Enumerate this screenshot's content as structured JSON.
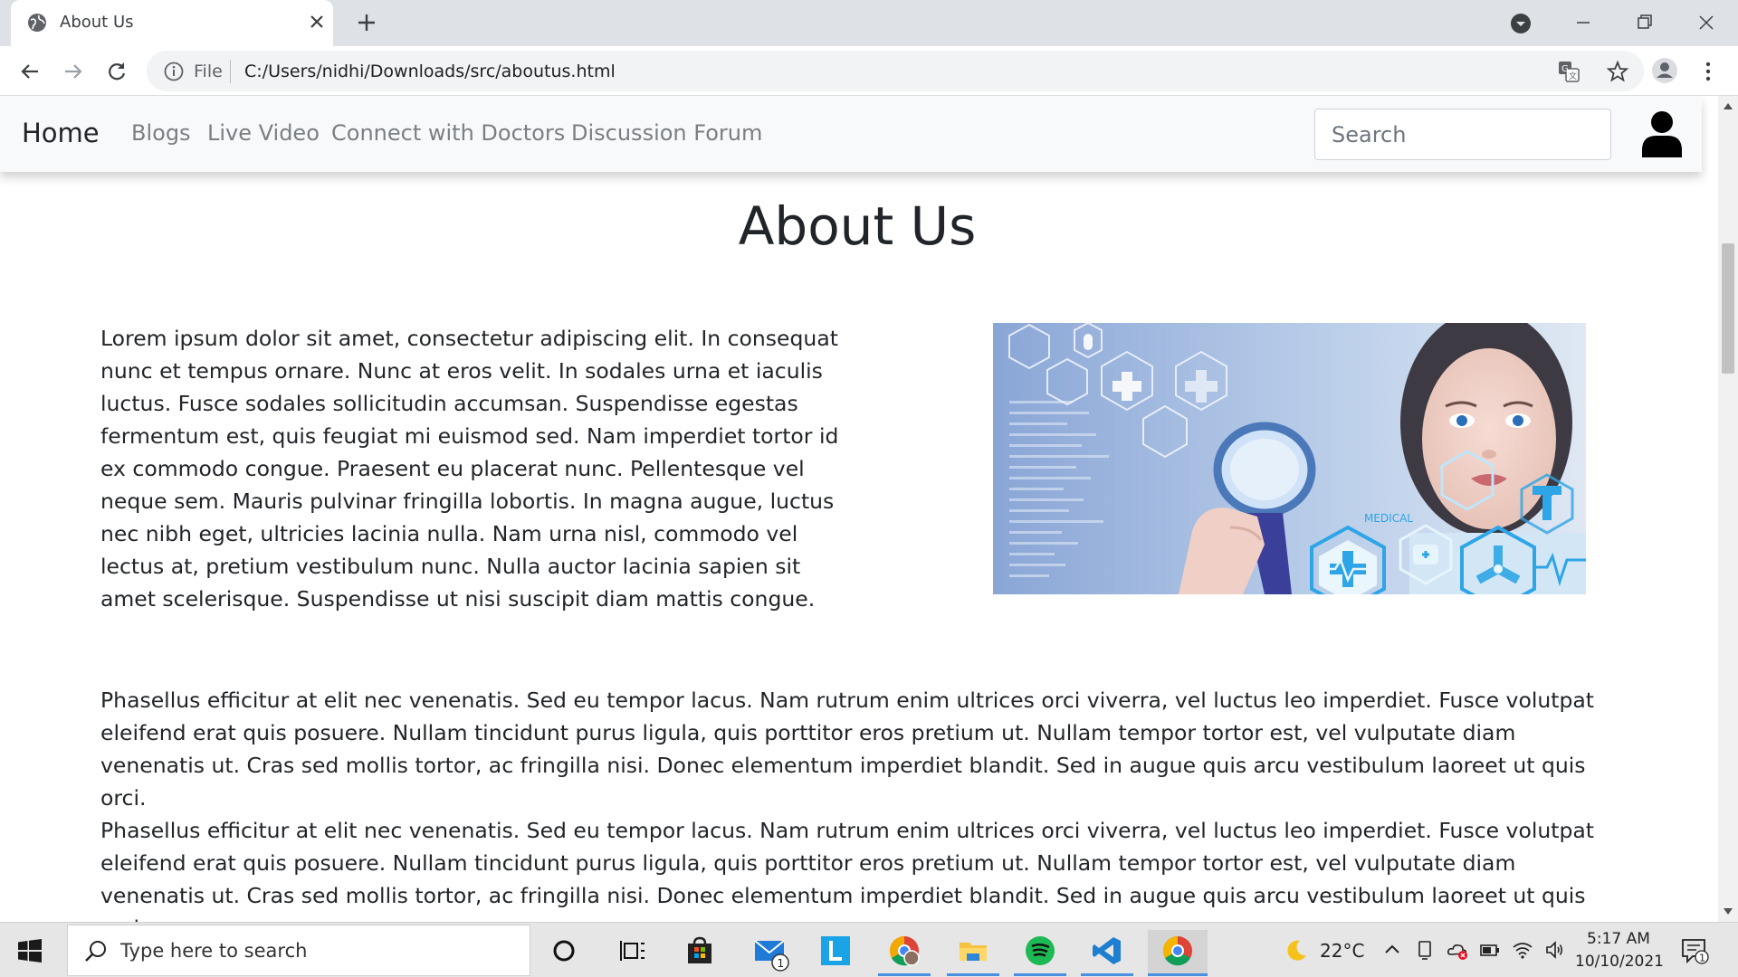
{
  "browser": {
    "tab_title": "About Us",
    "omnibox_scheme": "File",
    "omnibox_url": "C:/Users/nidhi/Downloads/src/aboutus.html"
  },
  "nav": {
    "brand": "Home",
    "links": [
      "Blogs",
      "Live Video",
      "Connect with Doctors",
      "Discussion Forum"
    ],
    "search_placeholder": "Search"
  },
  "page": {
    "title": "About Us",
    "intro": "Lorem ipsum dolor sit amet, consectetur adipiscing elit. In consequat nunc et tempus ornare. Nunc at eros velit. In sodales urna et iaculis luctus. Fusce sodales sollicitudin accumsan. Suspendisse egestas fermentum est, quis feugiat mi euismod sed. Nam imperdiet tortor id ex commodo congue. Praesent eu placerat nunc. Pellentesque vel neque sem. Mauris pulvinar fringilla lobortis. In magna augue, luctus nec nibh eget, ultricies lacinia nulla. Nam urna nisl, commodo vel lectus at, pretium vestibulum nunc. Nulla auctor lacinia sapien sit amet scelerisque. Suspendisse ut nisi suscipit diam mattis congue.",
    "image_label": "MEDICAL",
    "paragraphs": [
      "Phasellus efficitur at elit nec venenatis. Sed eu tempor lacus. Nam rutrum enim ultrices orci viverra, vel luctus leo imperdiet. Fusce volutpat eleifend erat quis posuere. Nullam tincidunt purus ligula, quis porttitor eros pretium ut. Nullam tempor tortor est, vel vulputate diam venenatis ut. Cras sed mollis tortor, ac fringilla nisi. Donec elementum imperdiet blandit. Sed in augue quis arcu vestibulum laoreet ut quis orci.",
      "Phasellus efficitur at elit nec venenatis. Sed eu tempor lacus. Nam rutrum enim ultrices orci viverra, vel luctus leo imperdiet. Fusce volutpat eleifend erat quis posuere. Nullam tincidunt purus ligula, quis porttitor eros pretium ut. Nullam tempor tortor est, vel vulputate diam venenatis ut. Cras sed mollis tortor, ac fringilla nisi. Donec elementum imperdiet blandit. Sed in augue quis arcu vestibulum laoreet ut quis orci."
    ]
  },
  "taskbar": {
    "search_placeholder": "Type here to search",
    "weather": "22°C",
    "time": "5:17 AM",
    "date": "10/10/2021",
    "mail_badge": "1",
    "notification_count": "1"
  },
  "colors": {
    "tabstrip": "#dee1e6",
    "navbar": "#f8f9fa",
    "nav_link": "#7a7f84",
    "taskbar": "#e6e6e6",
    "accent": "#4a8fe0"
  },
  "icons": [
    "globe-icon",
    "close-icon",
    "plus-icon",
    "back-icon",
    "forward-icon",
    "reload-icon",
    "info-icon",
    "translate-icon",
    "star-icon",
    "profile-icon",
    "menu-icon",
    "user-icon",
    "windows-icon",
    "search-icon",
    "cortana-icon",
    "task-view-icon"
  ]
}
